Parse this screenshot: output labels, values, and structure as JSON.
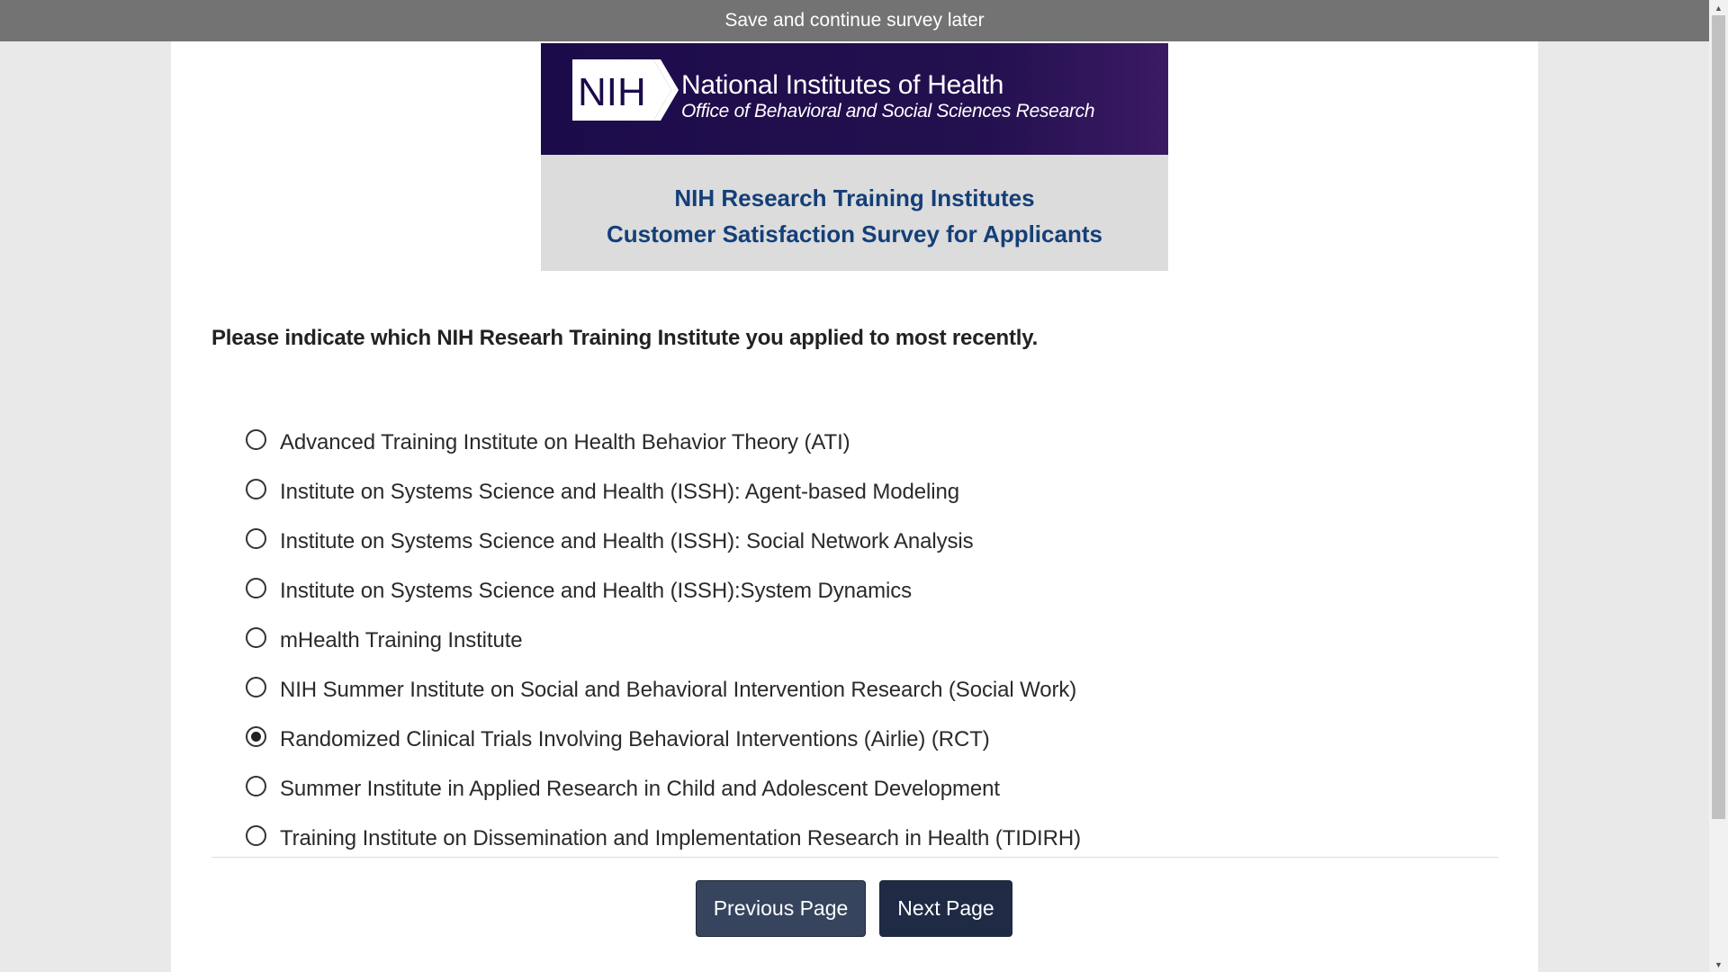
{
  "topbar": {
    "save_label": "Save and continue survey later"
  },
  "banner": {
    "logo_mark": "NIH",
    "org_name": "National Institutes of Health",
    "office_name": "Office of Behavioral and Social Sciences Research",
    "heading_line1": "NIH Research Training Institutes",
    "heading_line2": "Customer Satisfaction Survey for Applicants",
    "colors": {
      "logo_bg": "#1c0b4a",
      "heading_text": "#143f78",
      "panel_bg": "#dcdcdc"
    }
  },
  "question": {
    "text": "Please indicate which NIH Researh Training Institute you applied to most recently."
  },
  "options": [
    {
      "label": "Advanced Training Institute on Health Behavior Theory (ATI)",
      "selected": false
    },
    {
      "label": "Institute on Systems Science and Health (ISSH): Agent-based Modeling",
      "selected": false
    },
    {
      "label": "Institute on Systems Science and Health (ISSH): Social Network Analysis",
      "selected": false
    },
    {
      "label": "Institute on Systems Science and Health (ISSH):System Dynamics",
      "selected": false
    },
    {
      "label": "mHealth Training Institute",
      "selected": false
    },
    {
      "label": "NIH Summer Institute on Social and Behavioral Intervention Research (Social Work)",
      "selected": false
    },
    {
      "label": "Randomized Clinical Trials Involving Behavioral Interventions (Airlie) (RCT)",
      "selected": true
    },
    {
      "label": "Summer Institute in Applied Research in Child and Adolescent Development",
      "selected": false
    },
    {
      "label": "Training Institute on Dissemination and Implementation Research in Health (TIDIRH)",
      "selected": false
    }
  ],
  "navigation": {
    "previous_label": "Previous Page",
    "next_label": "Next Page",
    "button_color": "#2e3a4f"
  }
}
